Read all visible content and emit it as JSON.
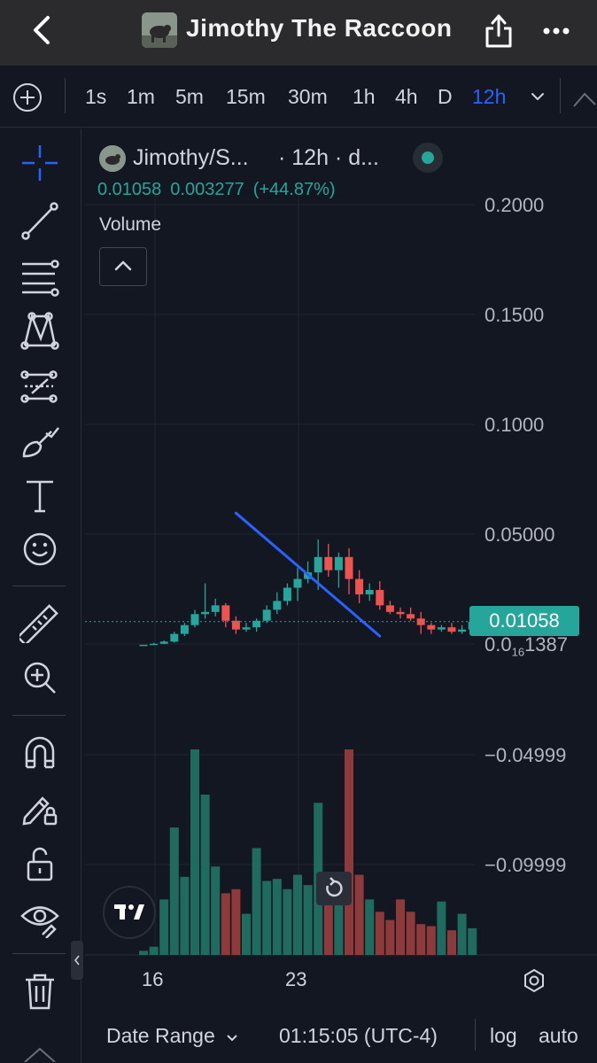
{
  "header": {
    "title": "Jimothy The Raccoon"
  },
  "intervals": [
    {
      "label": "1s",
      "active": false
    },
    {
      "label": "1m",
      "active": false
    },
    {
      "label": "5m",
      "active": false
    },
    {
      "label": "15m",
      "active": false
    },
    {
      "label": "30m",
      "active": false
    },
    {
      "label": "1h",
      "active": false
    },
    {
      "label": "4h",
      "active": false
    },
    {
      "label": "D",
      "active": false
    },
    {
      "label": "12h",
      "active": true
    }
  ],
  "tools": [
    "crosshair-icon",
    "trend-line-icon",
    "fib-retracement-icon",
    "pattern-icon",
    "prediction-icon",
    "brush-icon",
    "text-icon",
    "emoji-icon",
    "ruler-icon",
    "zoom-in-icon",
    "magnet-icon",
    "lock-drawing-icon",
    "unlock-icon",
    "eye-icon",
    "trash-icon"
  ],
  "legend": {
    "symbol": "Jimothy/S...",
    "meta": "· 12h · d...",
    "close": "0.01058",
    "change": "0.003277",
    "change_pct": "(+44.87%)",
    "volume_label": "Volume"
  },
  "price_axis": {
    "labels": [
      "0.2000",
      "0.1500",
      "0.1000",
      "0.05000",
      "−0.04999",
      "−0.09999"
    ],
    "low_label_prefix": "0.0",
    "low_label_sub": "16",
    "low_label_suffix": "1387",
    "last_price": "0.01058"
  },
  "time_axis": {
    "labels": [
      "16",
      "23"
    ]
  },
  "bottom": {
    "date_range": "Date Range",
    "clock": "01:15:05 (UTC-4)",
    "log": "log",
    "auto": "auto"
  },
  "colors": {
    "up": "#26a69a",
    "down": "#ef5350",
    "trendline": "#2962ff",
    "background": "#131722",
    "active_interval": "#2962ff"
  },
  "chart_data": {
    "type": "candlestick",
    "interval": "12h",
    "price_range": [
      -0.12,
      0.22
    ],
    "x_ticks": [
      "16",
      "23"
    ],
    "candles": [
      {
        "o": 5e-05,
        "h": 5e-05,
        "l": 5e-05,
        "c": 5e-05,
        "v": 2
      },
      {
        "o": 5e-05,
        "h": 0.001,
        "l": 5e-05,
        "c": 0.0005,
        "v": 4
      },
      {
        "o": 0.0005,
        "h": 0.002,
        "l": 0.0003,
        "c": 0.0015,
        "v": 27
      },
      {
        "o": 0.0015,
        "h": 0.006,
        "l": 0.001,
        "c": 0.005,
        "v": 62
      },
      {
        "o": 0.005,
        "h": 0.01,
        "l": 0.004,
        "c": 0.009,
        "v": 38
      },
      {
        "o": 0.009,
        "h": 0.016,
        "l": 0.008,
        "c": 0.014,
        "v": 100
      },
      {
        "o": 0.014,
        "h": 0.028,
        "l": 0.012,
        "c": 0.015,
        "v": 78
      },
      {
        "o": 0.015,
        "h": 0.021,
        "l": 0.013,
        "c": 0.018,
        "v": 43
      },
      {
        "o": 0.018,
        "h": 0.019,
        "l": 0.008,
        "c": 0.011,
        "v": 30
      },
      {
        "o": 0.011,
        "h": 0.013,
        "l": 0.005,
        "c": 0.007,
        "v": 32
      },
      {
        "o": 0.007,
        "h": 0.01,
        "l": 0.006,
        "c": 0.008,
        "v": 20
      },
      {
        "o": 0.008,
        "h": 0.012,
        "l": 0.006,
        "c": 0.011,
        "v": 52
      },
      {
        "o": 0.011,
        "h": 0.018,
        "l": 0.01,
        "c": 0.016,
        "v": 36
      },
      {
        "o": 0.016,
        "h": 0.024,
        "l": 0.014,
        "c": 0.02,
        "v": 37
      },
      {
        "o": 0.02,
        "h": 0.028,
        "l": 0.018,
        "c": 0.026,
        "v": 32
      },
      {
        "o": 0.026,
        "h": 0.035,
        "l": 0.02,
        "c": 0.03,
        "v": 39
      },
      {
        "o": 0.03,
        "h": 0.038,
        "l": 0.028,
        "c": 0.033,
        "v": 34
      },
      {
        "o": 0.033,
        "h": 0.048,
        "l": 0.025,
        "c": 0.04,
        "v": 74
      },
      {
        "o": 0.04,
        "h": 0.046,
        "l": 0.031,
        "c": 0.034,
        "v": 26
      },
      {
        "o": 0.034,
        "h": 0.042,
        "l": 0.026,
        "c": 0.04,
        "v": 29
      },
      {
        "o": 0.04,
        "h": 0.044,
        "l": 0.023,
        "c": 0.03,
        "v": 100
      },
      {
        "o": 0.03,
        "h": 0.034,
        "l": 0.019,
        "c": 0.023,
        "v": 39
      },
      {
        "o": 0.023,
        "h": 0.028,
        "l": 0.02,
        "c": 0.025,
        "v": 27
      },
      {
        "o": 0.025,
        "h": 0.029,
        "l": 0.016,
        "c": 0.018,
        "v": 21
      },
      {
        "o": 0.018,
        "h": 0.02,
        "l": 0.014,
        "c": 0.015,
        "v": 17
      },
      {
        "o": 0.015,
        "h": 0.017,
        "l": 0.012,
        "c": 0.014,
        "v": 27
      },
      {
        "o": 0.014,
        "h": 0.017,
        "l": 0.011,
        "c": 0.012,
        "v": 21
      },
      {
        "o": 0.012,
        "h": 0.015,
        "l": 0.005,
        "c": 0.009,
        "v": 15
      },
      {
        "o": 0.009,
        "h": 0.01,
        "l": 0.005,
        "c": 0.007,
        "v": 14
      },
      {
        "o": 0.007,
        "h": 0.009,
        "l": 0.006,
        "c": 0.008,
        "v": 26
      },
      {
        "o": 0.008,
        "h": 0.01,
        "l": 0.005,
        "c": 0.006,
        "v": 12
      },
      {
        "o": 0.006,
        "h": 0.009,
        "l": 0.005,
        "c": 0.007,
        "v": 20
      },
      {
        "o": 0.007,
        "h": 0.012,
        "l": 0.006,
        "c": 0.01058,
        "v": 13
      }
    ],
    "trendline": [
      {
        "i": 9,
        "p": 0.06
      },
      {
        "i": 23,
        "p": 0.004
      }
    ]
  }
}
